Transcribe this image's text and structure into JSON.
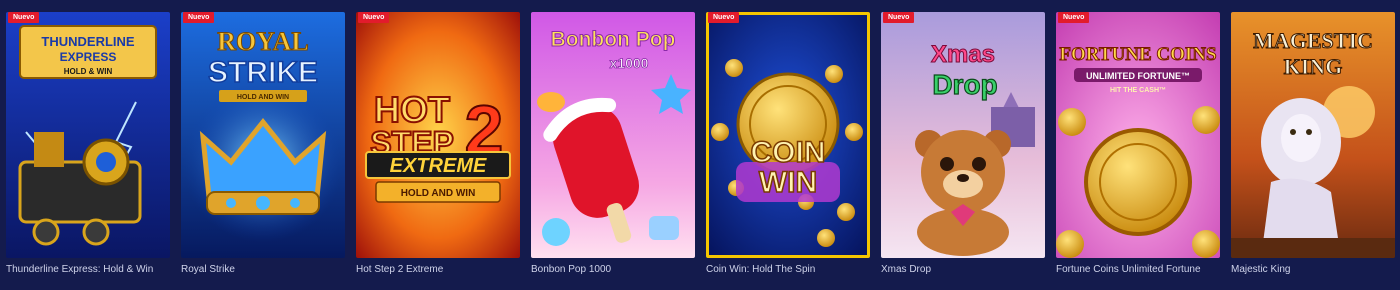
{
  "games": [
    {
      "title": "Thunderline Express: Hold & Win",
      "badge": "Nuevo",
      "logo_lines": [
        "THUNDERLINE",
        "EXPRESS",
        "HOLD & WIN"
      ],
      "colors": [
        "#0b1f8a",
        "#2c63e6"
      ],
      "icon": "train-icon"
    },
    {
      "title": "Royal Strike",
      "badge": "Nuevo",
      "logo_lines": [
        "ROYAL",
        "STRIKE",
        "HOLD AND WIN"
      ],
      "colors": [
        "#0a2a7a",
        "#1e6fe0"
      ],
      "icon": "crown-icon"
    },
    {
      "title": "Hot Step 2 Extreme",
      "badge": "Nuevo",
      "logo_lines": [
        "HOT",
        "STEP",
        "2",
        "EXTREME",
        "HOLD AND WIN"
      ],
      "colors": [
        "#c21d0b",
        "#ffb21a"
      ],
      "icon": "fire-icon"
    },
    {
      "title": "Bonbon Pop 1000",
      "badge": "",
      "logo_lines": [
        "Bonbon Pop",
        "x1000"
      ],
      "colors": [
        "#d867e8",
        "#ffb9e6"
      ],
      "icon": "popsicle-icon"
    },
    {
      "title": "Coin Win: Hold The Spin",
      "badge": "Nuevo",
      "logo_lines": [
        "COIN",
        "WIN"
      ],
      "colors": [
        "#061c78",
        "#123cb8"
      ],
      "icon": "coin-icon"
    },
    {
      "title": "Xmas Drop",
      "badge": "Nuevo",
      "logo_lines": [
        "Xmas",
        "Drop"
      ],
      "colors": [
        "#b7a9e0",
        "#f3c6d6"
      ],
      "icon": "bear-icon"
    },
    {
      "title": "Fortune Coins Unlimited Fortune",
      "badge": "Nuevo",
      "logo_lines": [
        "FORTUNE COINS",
        "UNLIMITED FORTUNE™",
        "HIT THE CASH™"
      ],
      "colors": [
        "#e04fc8",
        "#ff9ae0"
      ],
      "icon": "coin-icon"
    },
    {
      "title": "Majestic King",
      "badge": "",
      "logo_lines": [
        "MAGESTIC",
        "KING"
      ],
      "colors": [
        "#b3470c",
        "#f0a028"
      ],
      "icon": "lion-icon"
    }
  ],
  "selected_index": 4
}
